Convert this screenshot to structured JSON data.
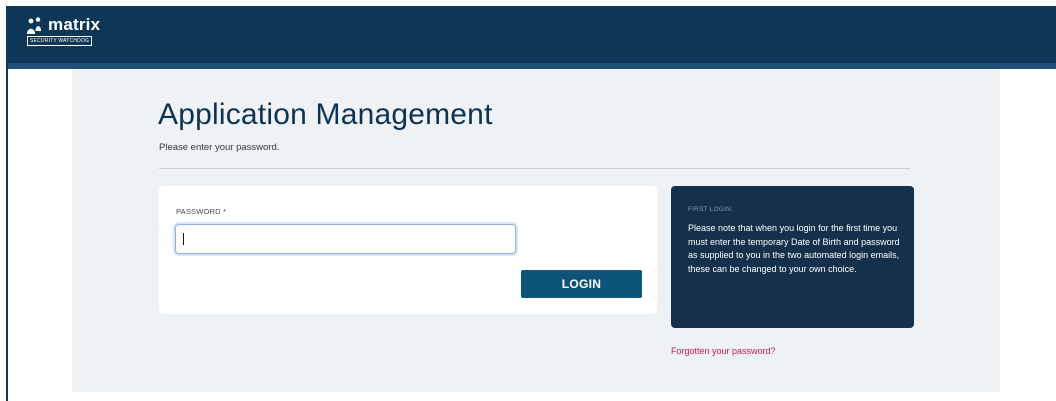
{
  "header": {
    "logo_text": "matrix",
    "logo_badge": "SECURITY WATCHDOG"
  },
  "main": {
    "title": "Application Management",
    "subtitle": "Please enter your password."
  },
  "login_form": {
    "password_label": "PASSWORD *",
    "password_value": "",
    "login_button": "LOGIN"
  },
  "info_panel": {
    "title": "FIRST LOGIN:",
    "text": "Please note that when you login for the first time you must enter the temporary Date of Birth and password as supplied to you in the two automated login emails, these can be changed to your own choice."
  },
  "forgot_link": "Forgotten your password?",
  "colors": {
    "header_bg": "#0e3656",
    "title": "#0d3354",
    "button": "#0d5578",
    "info_bg": "#14304a",
    "link": "#c2185b",
    "content_bg": "#eff2f4"
  },
  "icons": [
    "people-logo-icon"
  ]
}
